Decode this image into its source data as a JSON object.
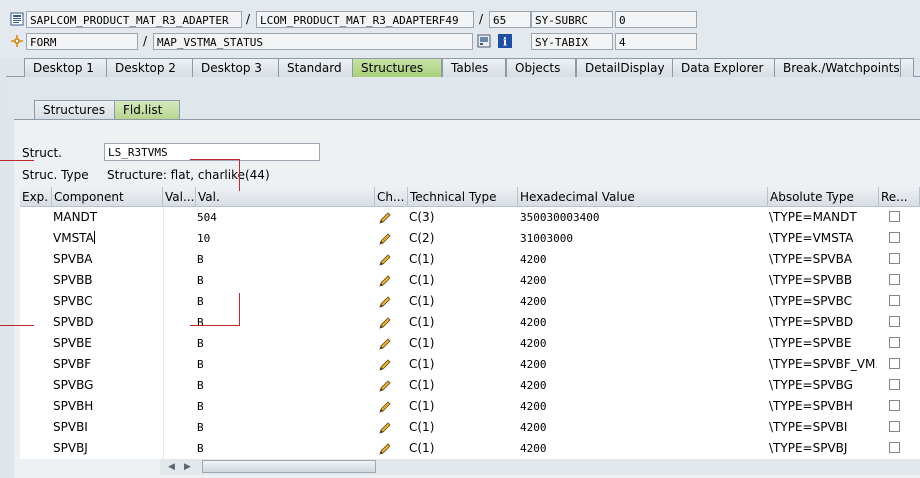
{
  "header": {
    "row1": {
      "program": "SAPLCOM_PRODUCT_MAT_R3_ADAPTER",
      "include": "LCOM_PRODUCT_MAT_R3_ADAPTERF49",
      "line": "65",
      "sysvar_name": "SY-SUBRC",
      "sysvar_value": "0",
      "sep1": "/",
      "sep2": "/"
    },
    "row2": {
      "event_type": "FORM",
      "event_name": "MAP_VSTMA_STATUS",
      "sysvar_name": "SY-TABIX",
      "sysvar_value": "4",
      "sep1": "/"
    }
  },
  "main_tabs": [
    {
      "label": "Desktop 1"
    },
    {
      "label": "Desktop 2"
    },
    {
      "label": "Desktop 3"
    },
    {
      "label": "Standard"
    },
    {
      "label": "Structures"
    },
    {
      "label": "Tables"
    },
    {
      "label": "Objects"
    },
    {
      "label": "DetailDisplay"
    },
    {
      "label": "Data Explorer"
    },
    {
      "label": "Break./Watchpoints"
    }
  ],
  "sub_tabs": [
    {
      "label": "Structures"
    },
    {
      "label": "Fld.list"
    }
  ],
  "struct": {
    "label": "Struct.",
    "value": "LS_R3TVMS",
    "type_label": "Struc. Type",
    "type_value": "Structure: flat, charlike(44)"
  },
  "grid": {
    "columns": [
      "Exp.",
      "Component",
      "Val...",
      "Val.",
      "Ch...",
      "Technical Type",
      "Hexadecimal Value",
      "Absolute Type",
      "Re..."
    ],
    "rows": [
      {
        "component": "MANDT",
        "val": "504",
        "tech": "C(3)",
        "hex": "350030003400",
        "abs": "\\TYPE=MANDT"
      },
      {
        "component": "VMSTA",
        "val": "10",
        "tech": "C(2)",
        "hex": "31003000",
        "abs": "\\TYPE=VMSTA"
      },
      {
        "component": "SPVBA",
        "val": "B",
        "tech": "C(1)",
        "hex": "4200",
        "abs": "\\TYPE=SPVBA"
      },
      {
        "component": "SPVBB",
        "val": "B",
        "tech": "C(1)",
        "hex": "4200",
        "abs": "\\TYPE=SPVBB"
      },
      {
        "component": "SPVBC",
        "val": "B",
        "tech": "C(1)",
        "hex": "4200",
        "abs": "\\TYPE=SPVBC"
      },
      {
        "component": "SPVBD",
        "val": "B",
        "tech": "C(1)",
        "hex": "4200",
        "abs": "\\TYPE=SPVBD"
      },
      {
        "component": "SPVBE",
        "val": "B",
        "tech": "C(1)",
        "hex": "4200",
        "abs": "\\TYPE=SPVBE"
      },
      {
        "component": "SPVBF",
        "val": "B",
        "tech": "C(1)",
        "hex": "4200",
        "abs": "\\TYPE=SPVBF_VM..."
      },
      {
        "component": "SPVBG",
        "val": "B",
        "tech": "C(1)",
        "hex": "4200",
        "abs": "\\TYPE=SPVBG"
      },
      {
        "component": "SPVBH",
        "val": "B",
        "tech": "C(1)",
        "hex": "4200",
        "abs": "\\TYPE=SPVBH"
      },
      {
        "component": "SPVBI",
        "val": "B",
        "tech": "C(1)",
        "hex": "4200",
        "abs": "\\TYPE=SPVBI"
      },
      {
        "component": "SPVBJ",
        "val": "B",
        "tech": "C(1)",
        "hex": "4200",
        "abs": "\\TYPE=SPVBJ"
      }
    ]
  },
  "icons": {
    "program": "program-icon",
    "event": "form-icon",
    "edit": "pencil-icon"
  },
  "colors": {
    "active_tab": "#a9cf7a",
    "annotation": "#c0272d"
  }
}
